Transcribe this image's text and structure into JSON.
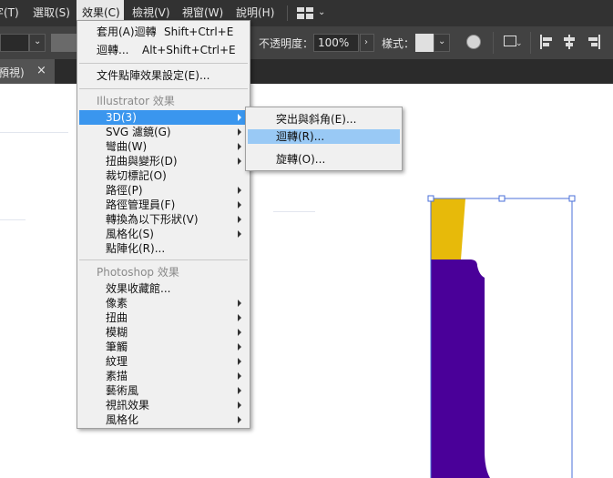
{
  "menubar": {
    "items": [
      {
        "label": "字(T)"
      },
      {
        "label": "選取(S)"
      },
      {
        "label": "效果(C)"
      },
      {
        "label": "檢視(V)"
      },
      {
        "label": "視窗(W)"
      },
      {
        "label": "說明(H)"
      }
    ]
  },
  "control_bar": {
    "opacity_label": "不透明度：",
    "opacity_value": "100%",
    "style_label": "樣式："
  },
  "tab": {
    "title": "預視)",
    "close": "×"
  },
  "effect_menu": {
    "items": [
      {
        "label": "套用(A)迴轉",
        "shortcut": "Shift+Ctrl+E"
      },
      {
        "label": "迴轉...",
        "shortcut": "Alt+Shift+Ctrl+E"
      },
      {
        "label": "文件點陣效果設定(E)..."
      }
    ],
    "illustrator_header": "Illustrator 效果",
    "illustrator_items": [
      {
        "label": "3D(3)"
      },
      {
        "label": "SVG 濾鏡(G)"
      },
      {
        "label": "彎曲(W)"
      },
      {
        "label": "扭曲與變形(D)"
      },
      {
        "label": "裁切標記(O)"
      },
      {
        "label": "路徑(P)"
      },
      {
        "label": "路徑管理員(F)"
      },
      {
        "label": "轉換為以下形狀(V)"
      },
      {
        "label": "風格化(S)"
      },
      {
        "label": "點陣化(R)..."
      }
    ],
    "photoshop_header": "Photoshop 效果",
    "photoshop_items": [
      {
        "label": "效果收藏館..."
      },
      {
        "label": "像素"
      },
      {
        "label": "扭曲"
      },
      {
        "label": "模糊"
      },
      {
        "label": "筆觸"
      },
      {
        "label": "紋理"
      },
      {
        "label": "素描"
      },
      {
        "label": "藝術風"
      },
      {
        "label": "視訊效果"
      },
      {
        "label": "風格化"
      }
    ]
  },
  "submenu_3d": {
    "items": [
      {
        "label": "突出與斜角(E)..."
      },
      {
        "label": "迴轉(R)..."
      },
      {
        "label": "旋轉(O)..."
      }
    ]
  },
  "colors": {
    "menubar_bg": "#323232",
    "highlight": "#3a96ee",
    "sub_highlight": "#99c9f5",
    "shape_yellow": "#e7ba0a",
    "shape_purple": "#4a0099",
    "selection_blue": "#4a6fd8"
  }
}
